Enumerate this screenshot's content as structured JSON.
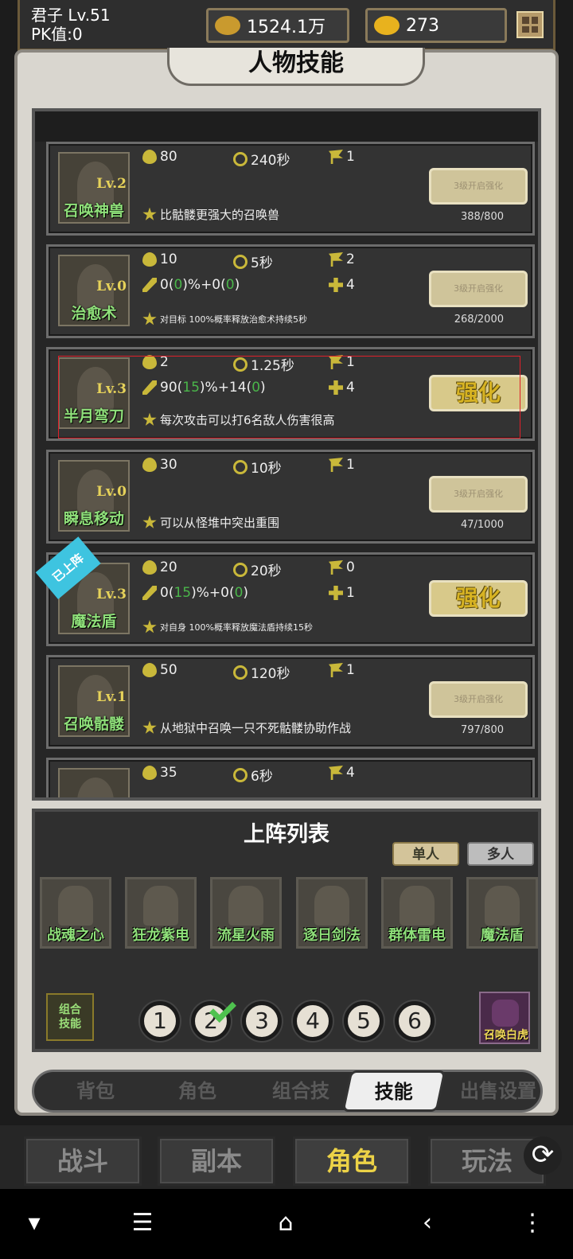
{
  "topbar": {
    "player_name": "君子  Lv.51",
    "pk_value": "PK值:0",
    "gold": "1524.1万",
    "ingots": "273"
  },
  "panel_title": "人物技能",
  "skills": [
    {
      "name": "召唤神兽",
      "level": "Lv.2",
      "mp": "80",
      "cooldown": "240秒",
      "range": "1",
      "desc": "比骷髅更强大的召唤兽",
      "button": "3级开启强化",
      "progress": "388/800"
    },
    {
      "name": "治愈术",
      "level": "Lv.0",
      "mp": "10",
      "cooldown": "5秒",
      "range": "2",
      "power_a": "0(",
      "power_a_bonus": "0",
      "power_b": ")%+0(",
      "power_b_bonus": "0",
      "power_c": ")",
      "targets": "4",
      "desc": "对目标 100%概率释放治愈术持续5秒",
      "button": "3级开启强化",
      "progress": "268/2000"
    },
    {
      "name": "半月弯刀",
      "level": "Lv.3",
      "mp": "2",
      "cooldown": "1.25秒",
      "range": "1",
      "power_a": "90(",
      "power_a_bonus": "15",
      "power_b": ")%+14(",
      "power_b_bonus": "0",
      "power_c": ")",
      "targets": "4",
      "desc": "每次攻击可以打6名敌人伤害很高",
      "button": "强化"
    },
    {
      "name": "瞬息移动",
      "level": "Lv.0",
      "mp": "30",
      "cooldown": "10秒",
      "range": "1",
      "desc": "可以从怪堆中突出重围",
      "button": "3级开启强化",
      "progress": "47/1000"
    },
    {
      "name": "魔法盾",
      "level": "Lv.3",
      "badge": "已上阵",
      "mp": "20",
      "cooldown": "20秒",
      "range": "0",
      "power_a": "0(",
      "power_a_bonus": "15",
      "power_b": ")%+0(",
      "power_b_bonus": "0",
      "power_c": ")",
      "targets": "1",
      "desc": "对自身 100%概率释放魔法盾持续15秒",
      "button": "强化"
    },
    {
      "name": "召唤骷髅",
      "level": "Lv.1",
      "mp": "50",
      "cooldown": "120秒",
      "range": "1",
      "desc": "从地狱中召唤一只不死骷髅协助作战",
      "button": "3级开启强化",
      "progress": "797/800"
    },
    {
      "mp": "35",
      "cooldown": "6秒",
      "range": "4"
    }
  ],
  "lineup": {
    "title": "上阵列表",
    "mode_single": "单人",
    "mode_multi": "多人",
    "slots": [
      "战魂之心",
      "狂龙紫电",
      "流星火雨",
      "逐日剑法",
      "群体雷电",
      "魔法盾"
    ],
    "combo_label": "组合\n技能",
    "presets": [
      "1",
      "2",
      "3",
      "4",
      "5",
      "6"
    ],
    "selected_preset": "2",
    "summon_label": "召唤白虎"
  },
  "subtabs": [
    "背包",
    "角色",
    "组合技",
    "技能",
    "出售设置"
  ],
  "active_subtab": "技能",
  "maintabs": [
    "战斗",
    "副本",
    "角色",
    "玩法"
  ],
  "active_maintab": "角色",
  "colors": {
    "accent_gold": "#ecd247",
    "skill_name_green": "#8fe07a",
    "bonus_green": "#4ab64a",
    "highlight_red": "#e0202a"
  }
}
